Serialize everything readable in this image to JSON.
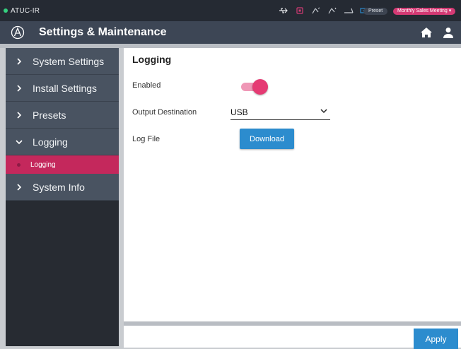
{
  "status_bar": {
    "device_name": "ATUC-IR",
    "icons": [
      "usb-icon",
      "record-indicator-icon",
      "mic-mute-icon",
      "mic-icon",
      "camera-icon",
      "display-icon"
    ],
    "preset_label": "Preset",
    "meeting_label": "Monthly Sales Meeting",
    "colors": {
      "status_dot": "#35d07f",
      "meeting_pill": "#d43a74"
    }
  },
  "header": {
    "title": "Settings & Maintenance",
    "icons": [
      "logo-icon",
      "home-icon",
      "user-icon"
    ]
  },
  "sidebar": {
    "items": [
      {
        "label": "System Settings",
        "expanded": false
      },
      {
        "label": "Install Settings",
        "expanded": false
      },
      {
        "label": "Presets",
        "expanded": false
      },
      {
        "label": "Logging",
        "expanded": true
      },
      {
        "label": "System Info",
        "expanded": false
      }
    ],
    "sub_items": [
      {
        "label": "Logging",
        "selected": true
      }
    ]
  },
  "main": {
    "title": "Logging",
    "enabled_label": "Enabled",
    "enabled_value": true,
    "output_destination_label": "Output Destination",
    "output_destination_value": "USB",
    "log_file_label": "Log File",
    "download_label": "Download"
  },
  "footer": {
    "apply_label": "Apply"
  },
  "colors": {
    "accent": "#2c8cce",
    "selected": "#c4285c",
    "toggle_on": "#e53a73"
  }
}
